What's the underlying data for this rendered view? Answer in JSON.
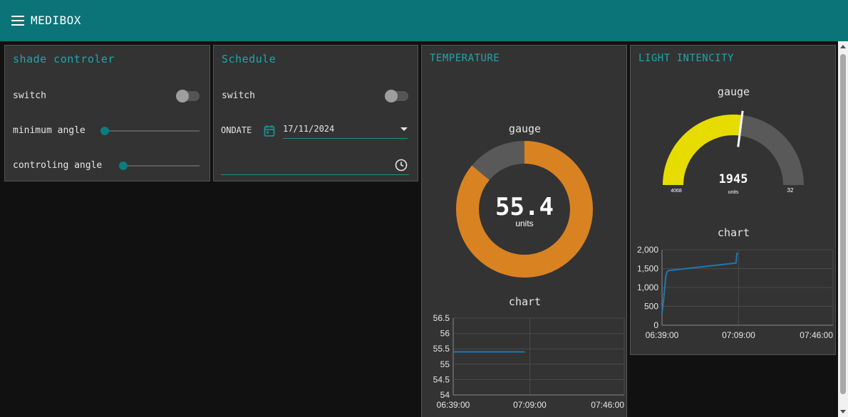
{
  "header": {
    "title": "MEDIBOX",
    "menu_icon": "hamburger-menu-icon"
  },
  "shade": {
    "title": "shade controler",
    "switch_label": "switch",
    "switch_on": false,
    "min_angle_label": "minimum angle",
    "min_angle_fraction": 0.0,
    "ctrl_angle_label": "controling angle",
    "ctrl_angle_fraction": 0.0
  },
  "schedule": {
    "title": "Schedule",
    "switch_label": "switch",
    "switch_on": false,
    "ondate_label": "ONDATE",
    "date_value": "17/11/2024",
    "calendar_icon": "calendar-icon",
    "time_value": "",
    "clock_icon": "clock-icon"
  },
  "temperature": {
    "title": "TEMPERATURE",
    "gauge_title": "gauge",
    "gauge_value": "55.4",
    "gauge_units": "units",
    "gauge_fill_fraction": 0.86,
    "chart_title": "chart"
  },
  "light": {
    "title": "LIGHT INTENCITY",
    "gauge_title": "gauge",
    "gauge_value": "1945",
    "gauge_units": "units",
    "gauge_min_label": "4068",
    "gauge_max_label": "32",
    "gauge_fill_fraction": 0.54,
    "chart_title": "chart"
  },
  "colors": {
    "accent": "#0b7478",
    "title_text": "#1ea7ad",
    "temp_gauge": "#d98222",
    "light_gauge": "#e6dc00",
    "gauge_bg": "#595959",
    "line": "#1f77b4"
  },
  "chart_data": [
    {
      "type": "line",
      "title": "chart",
      "x_ticks": [
        "06:39:00",
        "07:09:00",
        "07:46:00"
      ],
      "y_ticks": [
        "54",
        "54.5",
        "55",
        "55.5",
        "56",
        "56.5"
      ],
      "ylim": [
        54,
        56.5
      ],
      "grid": true,
      "series": [
        {
          "x": [
            "06:39:00",
            "07:07:00"
          ],
          "y": [
            55.4,
            55.4
          ]
        }
      ]
    },
    {
      "type": "line",
      "title": "chart",
      "x_ticks": [
        "06:39:00",
        "07:09:00",
        "07:46:00"
      ],
      "y_ticks": [
        "0",
        "500",
        "1,000",
        "1,500",
        "2,000"
      ],
      "ylim": [
        0,
        2000
      ],
      "grid": true,
      "series": [
        {
          "x": [
            "06:39:00",
            "06:39:30",
            "06:40:00",
            "06:40:30",
            "06:41:00",
            "06:41:30",
            "07:08:00",
            "07:08:10",
            "07:08:20",
            "07:08:30"
          ],
          "y": [
            300,
            600,
            950,
            1300,
            1420,
            1450,
            1650,
            1750,
            1920,
            1870
          ]
        }
      ]
    }
  ]
}
